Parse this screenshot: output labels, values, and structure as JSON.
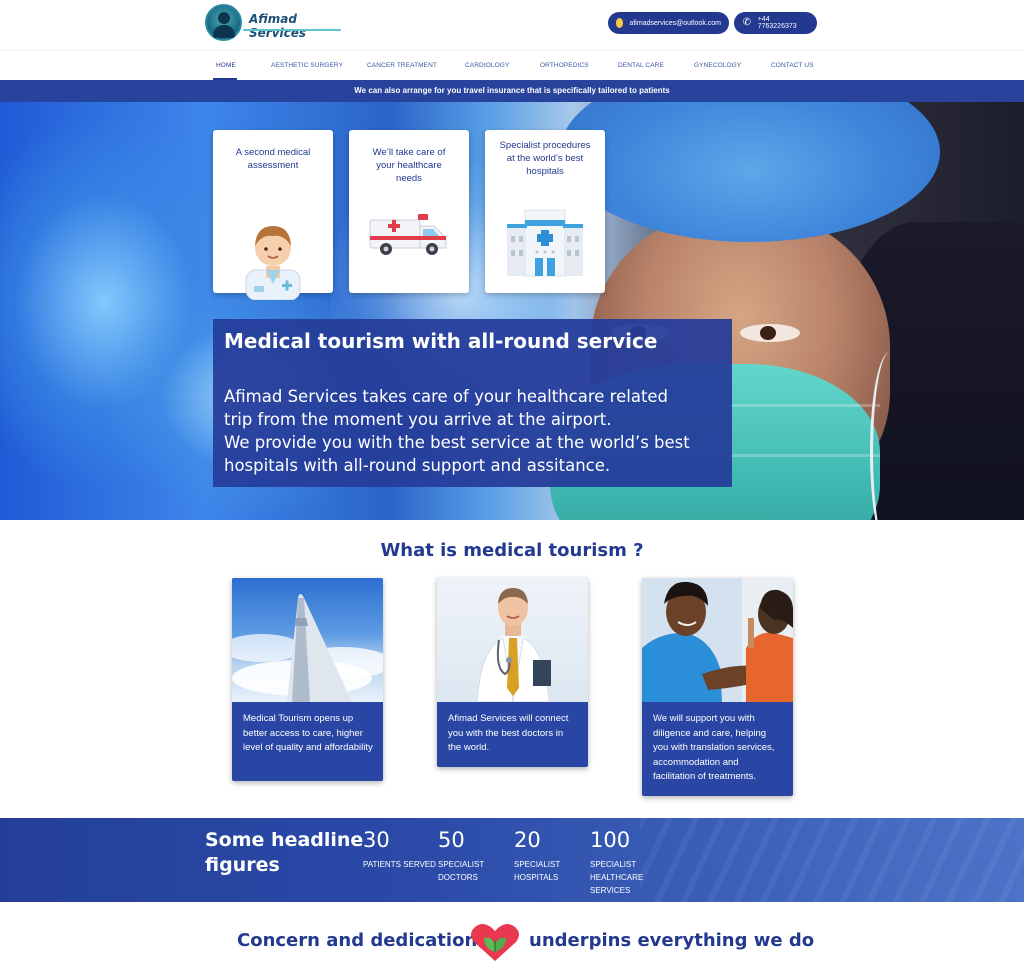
{
  "brand": {
    "name": "Afimad Services"
  },
  "contact": {
    "email": "afimadservices@outlook.com",
    "phone": "+44 7763226373"
  },
  "nav": {
    "items": [
      {
        "label": "HOME",
        "active": true
      },
      {
        "label": "AESTHETIC SURGERY"
      },
      {
        "label": "CANCER TREATMENT"
      },
      {
        "label": "CARDIOLOGY"
      },
      {
        "label": "ORTHOPEDICS"
      },
      {
        "label": "DENTAL CARE"
      },
      {
        "label": "GYNECOLOGY"
      },
      {
        "label": "CONTACT US"
      }
    ]
  },
  "banner": {
    "text": "We can also arrange for you travel insurance that is specifically tailored to patients"
  },
  "hero": {
    "cards": [
      {
        "text": "A second medical assessment",
        "icon": "doctor-icon"
      },
      {
        "text": "We’ll take care of your healthcare needs",
        "icon": "ambulance-icon"
      },
      {
        "text": "Specialist procedures at the world’s best hospitals",
        "icon": "hospital-icon"
      }
    ],
    "title": "Medical tourism with all-round service",
    "body": "Afimad Services takes care of your healthcare related\ntrip from the moment you arrive at the airport.\nWe provide you with the best service at the world’s best\nhospitals with all-round support and assitance."
  },
  "medical_tourism": {
    "title": "What is medical tourism ?",
    "cards": [
      {
        "text": "Medical Tourism opens up better access to care, higher level of quality and affordability"
      },
      {
        "text": "Afimad Services will connect you with the best doctors in the world."
      },
      {
        "text": "We will support you with diligence and care, helping you with translation services, accommodation and facilitation of treatments."
      }
    ]
  },
  "figures": {
    "title": "Some headline\nfigures",
    "items": [
      {
        "value": "30",
        "label": "PATIENTS SERVED"
      },
      {
        "value": "50",
        "label": "SPECIALIST\nDOCTORS"
      },
      {
        "value": "20",
        "label": "SPECIALIST\nHOSPITALS"
      },
      {
        "value": "100",
        "label": "SPECIALIST\nHEALTHCARE\nSERVICES"
      }
    ]
  },
  "tagline": {
    "left": "Concern and dedication",
    "right": "underpins everything we do"
  },
  "colors": {
    "primary": "#22398f",
    "banner": "#27439b",
    "accent_teal": "#5cc3cf",
    "heart_red": "#e8394f",
    "leaf_green": "#4caf50"
  }
}
